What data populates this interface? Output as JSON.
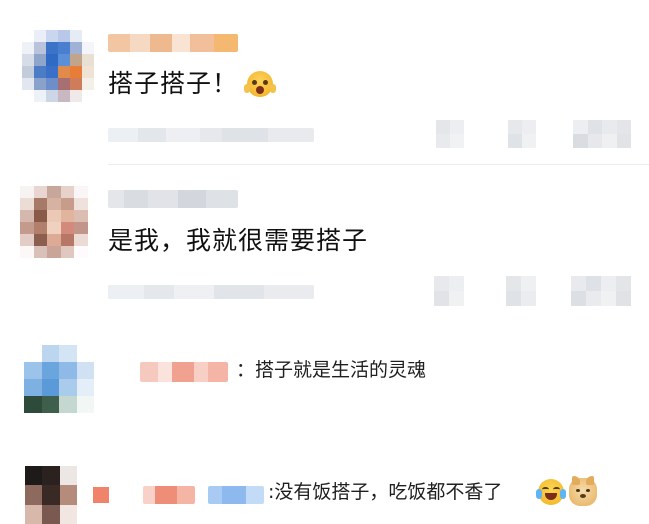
{
  "comments": [
    {
      "text": "搭子搭子！",
      "emoji": "screaming-face-icon"
    },
    {
      "text": "是我，我就很需要搭子"
    }
  ],
  "replies": [
    {
      "text": "：搭子就是生活的灵魂"
    },
    {
      "text": ":没有饭搭子，吃饭都不香了",
      "emojis": [
        "crying-laughing-face-icon",
        "doge-face-icon"
      ]
    }
  ]
}
